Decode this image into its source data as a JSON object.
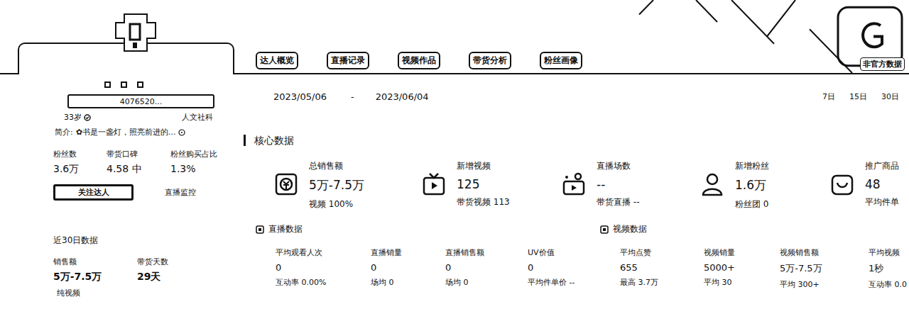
{
  "header": {
    "tabs": [
      {
        "label": "达人概览"
      },
      {
        "label": "直播记录"
      },
      {
        "label": "视频作品"
      },
      {
        "label": "带货分析"
      },
      {
        "label": "粉丝画像"
      }
    ],
    "watermark": "非官方数据"
  },
  "profile": {
    "id": "4076520...",
    "age": "33岁",
    "category": "人文社科",
    "bio_label": "简介:",
    "bio": "✿书是一盏灯，照亮前进的...",
    "stats": [
      {
        "label": "粉丝数",
        "value": "3.6万"
      },
      {
        "label": "带货口碑",
        "value": "4.58 中"
      },
      {
        "label": "粉丝购买占比",
        "value": "1.3%"
      }
    ],
    "buttons": [
      {
        "label": "关注达人",
        "kind": "outlined"
      },
      {
        "label": "直播监控",
        "kind": "text"
      }
    ]
  },
  "recent": {
    "title": "近30日数据",
    "stats": [
      {
        "label": "销售额",
        "value": "5万-7.5万"
      },
      {
        "label": "带货天数",
        "value": "29天"
      }
    ],
    "note": "纯视频"
  },
  "date_range": {
    "start": "2023/05/06",
    "separator": "-",
    "end": "2023/06/04"
  },
  "periods": [
    {
      "label": "7日"
    },
    {
      "label": "15日"
    },
    {
      "label": "30日"
    }
  ],
  "core": {
    "title": "核心数据",
    "metrics": [
      {
        "kind": "sales",
        "label": "总销售额",
        "value": "5万-7.5万",
        "sub": "视频 100%"
      },
      {
        "kind": "video",
        "label": "新增视频",
        "value": "125",
        "sub": "带货视频 113"
      },
      {
        "kind": "live",
        "label": "直播场数",
        "value": "--",
        "sub": "带货直播 --"
      },
      {
        "kind": "fans",
        "label": "新增粉丝",
        "value": "1.6万",
        "sub": "粉丝团 0"
      },
      {
        "kind": "goods",
        "label": "推广商品",
        "value": "48",
        "sub": "平均件单"
      }
    ]
  },
  "live": {
    "title": "直播数据",
    "stats": [
      {
        "label": "平均观看人次",
        "value": "0",
        "sub": "互动率 0.00%"
      },
      {
        "label": "直播销量",
        "value": "0",
        "sub": "场均 0"
      },
      {
        "label": "直播销售额",
        "value": "0",
        "sub": "场均 0"
      },
      {
        "label": "UV价值",
        "value": "0",
        "sub": "平均件单价 --"
      }
    ]
  },
  "video": {
    "title": "视频数据",
    "stats": [
      {
        "label": "平均点赞",
        "value": "655",
        "sub": "最高 3.7万"
      },
      {
        "label": "视频销量",
        "value": "5000+",
        "sub": "平均 30"
      },
      {
        "label": "视频销售额",
        "value": "5万-7.5万",
        "sub": "平均 300+"
      },
      {
        "label": "平均视频",
        "value": "1秒",
        "sub": "互动率 0.0"
      }
    ]
  }
}
